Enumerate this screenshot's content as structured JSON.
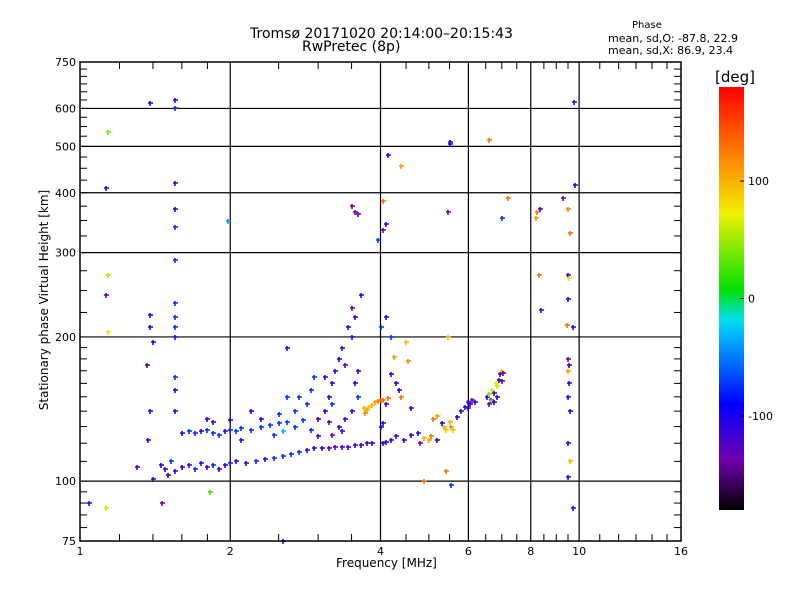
{
  "chart_data": {
    "type": "scatter",
    "title": "Tromsø 20171020 20:14:00–20:15:43",
    "subtitle": "RwPretec (8p)",
    "legend": {
      "title": "Phase",
      "line_o": "mean, sd,O: -87.8, 22.9",
      "line_x": "mean, sd,X:  86.9, 23.4",
      "placement": "top-right"
    },
    "xlabel": "Frequency [MHz]",
    "ylabel": "Stationary phase Virtual Height [km]",
    "xscale": "log2",
    "yscale": "log10",
    "xlim": [
      1,
      16
    ],
    "ylim": [
      75,
      750
    ],
    "xticks": [
      "1",
      "2",
      "4",
      "6",
      "8",
      "10",
      "16"
    ],
    "xtick_values": [
      1,
      2,
      4,
      6,
      8,
      10,
      16
    ],
    "yticks": [
      "75",
      "100",
      "200",
      "300",
      "400",
      "500",
      "600",
      "750"
    ],
    "ytick_values": [
      75,
      100,
      200,
      300,
      400,
      500,
      600,
      750
    ],
    "grid_x": [
      2,
      4,
      6,
      8,
      10
    ],
    "grid_y": [
      100,
      200,
      300,
      400,
      500,
      600
    ],
    "colorbar": {
      "label": "[deg]",
      "range": [
        -180,
        180
      ],
      "ticks": [
        "100",
        "0",
        "-100"
      ],
      "tick_values": [
        100,
        0,
        -100
      ]
    },
    "point_format": [
      "frequency_MHz",
      "height_km",
      "phase_deg"
    ],
    "points": [
      [
        1.45,
        108,
        -110
      ],
      [
        1.48,
        106,
        -110
      ],
      [
        1.52,
        110,
        -75
      ],
      [
        1.55,
        105,
        -110
      ],
      [
        1.6,
        107,
        -110
      ],
      [
        1.65,
        108,
        -110
      ],
      [
        1.7,
        106,
        -75
      ],
      [
        1.75,
        109,
        -110
      ],
      [
        1.8,
        107,
        -110
      ],
      [
        1.85,
        108,
        -75
      ],
      [
        1.9,
        106,
        -110
      ],
      [
        1.95,
        108,
        -110
      ],
      [
        2.0,
        109,
        -75
      ],
      [
        2.05,
        110,
        -110
      ],
      [
        2.15,
        109,
        -110
      ],
      [
        2.25,
        110,
        -75
      ],
      [
        2.35,
        111,
        -110
      ],
      [
        2.45,
        112,
        -75
      ],
      [
        2.55,
        113,
        -75
      ],
      [
        2.65,
        114,
        -75
      ],
      [
        2.75,
        115,
        -75
      ],
      [
        2.85,
        116,
        -110
      ],
      [
        2.95,
        117,
        -110
      ],
      [
        3.05,
        117,
        -110
      ],
      [
        3.15,
        117,
        -120
      ],
      [
        3.25,
        118,
        -120
      ],
      [
        3.35,
        118,
        -120
      ],
      [
        3.45,
        118,
        -110
      ],
      [
        3.55,
        119,
        -120
      ],
      [
        3.65,
        119,
        -110
      ],
      [
        3.75,
        120,
        -110
      ],
      [
        3.85,
        120,
        -110
      ],
      [
        1.3,
        107,
        -120
      ],
      [
        1.5,
        103,
        -110
      ],
      [
        1.4,
        101,
        -110
      ],
      [
        1.6,
        126,
        -110
      ],
      [
        1.65,
        127,
        -75
      ],
      [
        1.7,
        126,
        -75
      ],
      [
        1.75,
        127,
        -110
      ],
      [
        1.8,
        128,
        -75
      ],
      [
        1.85,
        126,
        -75
      ],
      [
        1.9,
        125,
        -75
      ],
      [
        1.95,
        127,
        -110
      ],
      [
        2.0,
        128,
        -75
      ],
      [
        2.05,
        127,
        -75
      ],
      [
        2.1,
        129,
        -75
      ],
      [
        2.2,
        128,
        -75
      ],
      [
        2.3,
        130,
        -75
      ],
      [
        2.4,
        131,
        -75
      ],
      [
        2.5,
        132,
        -75
      ],
      [
        2.6,
        133,
        -75
      ],
      [
        2.7,
        130,
        -75
      ],
      [
        2.8,
        134,
        -75
      ],
      [
        2.9,
        128,
        -75
      ],
      [
        3.0,
        124,
        -110
      ],
      [
        3.0,
        135,
        -110
      ],
      [
        3.1,
        140,
        -110
      ],
      [
        3.15,
        150,
        -110
      ],
      [
        3.2,
        145,
        -75
      ],
      [
        3.2,
        160,
        -110
      ],
      [
        3.1,
        165,
        -110
      ],
      [
        3.25,
        170,
        -110
      ],
      [
        3.3,
        130,
        -110
      ],
      [
        3.3,
        180,
        -110
      ],
      [
        3.4,
        135,
        -120
      ],
      [
        3.4,
        175,
        -140
      ],
      [
        3.35,
        190,
        -110
      ],
      [
        3.5,
        140,
        -110
      ],
      [
        3.5,
        200,
        -110
      ],
      [
        3.45,
        210,
        -110
      ],
      [
        3.55,
        220,
        -110
      ],
      [
        3.55,
        160,
        -110
      ],
      [
        3.6,
        170,
        -110
      ],
      [
        3.6,
        150,
        -75
      ],
      [
        3.5,
        230,
        -140
      ],
      [
        3.65,
        245,
        -110
      ],
      [
        2.85,
        145,
        -75
      ],
      [
        2.9,
        155,
        -75
      ],
      [
        2.95,
        165,
        -75
      ],
      [
        2.75,
        150,
        -75
      ],
      [
        2.7,
        140,
        -75
      ],
      [
        2.5,
        138,
        -75
      ],
      [
        2.6,
        150,
        -75
      ],
      [
        2.3,
        135,
        -110
      ],
      [
        2.2,
        140,
        -110
      ],
      [
        1.8,
        135,
        -110
      ],
      [
        1.85,
        133,
        -110
      ],
      [
        2.45,
        125,
        -75
      ],
      [
        2.55,
        127,
        -30
      ],
      [
        2.1,
        122,
        -110
      ],
      [
        2.0,
        134,
        -110
      ],
      [
        3.2,
        125,
        -140
      ],
      [
        3.35,
        127,
        -110
      ],
      [
        3.15,
        133,
        -140
      ],
      [
        3.7,
        142,
        100
      ],
      [
        3.75,
        141,
        110
      ],
      [
        3.8,
        143,
        90
      ],
      [
        3.85,
        144,
        100
      ],
      [
        3.9,
        146,
        110
      ],
      [
        3.95,
        147,
        120
      ],
      [
        4.0,
        148,
        140
      ],
      [
        4.05,
        148,
        130
      ],
      [
        4.15,
        149,
        130
      ],
      [
        3.72,
        139,
        120
      ],
      [
        4.1,
        145,
        -110
      ],
      [
        4.0,
        130,
        -110
      ],
      [
        4.05,
        132,
        -110
      ],
      [
        4.05,
        120,
        -110
      ],
      [
        4.1,
        121,
        -110
      ],
      [
        4.2,
        122,
        -110
      ],
      [
        4.3,
        124,
        -110
      ],
      [
        4.45,
        122,
        -110
      ],
      [
        4.6,
        125,
        -110
      ],
      [
        4.75,
        126,
        -110
      ],
      [
        4.8,
        120,
        -140
      ],
      [
        4.9,
        123,
        100
      ],
      [
        5.0,
        122,
        110
      ],
      [
        5.05,
        124,
        130
      ],
      [
        5.2,
        122,
        -110
      ],
      [
        5.3,
        132,
        -110
      ],
      [
        5.35,
        130,
        100
      ],
      [
        5.4,
        128,
        90
      ],
      [
        5.5,
        133,
        100
      ],
      [
        5.55,
        130,
        120
      ],
      [
        5.6,
        128,
        90
      ],
      [
        5.7,
        136,
        -110
      ],
      [
        5.8,
        140,
        -110
      ],
      [
        5.9,
        143,
        -110
      ],
      [
        6.0,
        146,
        -110
      ],
      [
        6.05,
        145,
        -110
      ],
      [
        6.0,
        142,
        -110
      ],
      [
        5.1,
        135,
        130
      ],
      [
        5.2,
        137,
        110
      ],
      [
        4.6,
        142,
        -110
      ],
      [
        4.4,
        150,
        130
      ],
      [
        4.3,
        160,
        -110
      ],
      [
        4.2,
        167,
        -110
      ],
      [
        4.35,
        155,
        -110
      ],
      [
        4.5,
        195,
        100
      ],
      [
        4.55,
        178,
        120
      ],
      [
        4.2,
        200,
        -75
      ],
      [
        5.45,
        200,
        100
      ],
      [
        4.25,
        182,
        110
      ],
      [
        6.55,
        150,
        -110
      ],
      [
        6.6,
        152,
        40
      ],
      [
        6.65,
        148,
        -140
      ],
      [
        6.7,
        155,
        80
      ],
      [
        6.75,
        153,
        -110
      ],
      [
        6.8,
        160,
        70
      ],
      [
        6.85,
        158,
        60
      ],
      [
        6.9,
        163,
        -110
      ],
      [
        6.95,
        167,
        -110
      ],
      [
        7.0,
        170,
        90
      ],
      [
        6.7,
        147,
        40
      ],
      [
        6.75,
        146,
        -110
      ],
      [
        6.6,
        145,
        -130
      ],
      [
        7.05,
        168,
        -140
      ],
      [
        6.85,
        150,
        -110
      ],
      [
        6.2,
        146,
        -110
      ],
      [
        6.1,
        148,
        -140
      ],
      [
        7.0,
        162,
        -140
      ],
      [
        9.5,
        270,
        -110
      ],
      [
        9.55,
        265,
        80
      ],
      [
        9.5,
        240,
        -110
      ],
      [
        9.45,
        212,
        130
      ],
      [
        9.5,
        180,
        -140
      ],
      [
        9.55,
        175,
        -110
      ],
      [
        9.5,
        170,
        110
      ],
      [
        9.55,
        160,
        -110
      ],
      [
        9.5,
        150,
        -110
      ],
      [
        9.6,
        140,
        -110
      ],
      [
        9.5,
        120,
        -110
      ],
      [
        9.6,
        110,
        100
      ],
      [
        9.5,
        102,
        -110
      ],
      [
        9.7,
        88,
        -110
      ],
      [
        9.7,
        210,
        -110
      ],
      [
        9.3,
        390,
        -140
      ],
      [
        9.5,
        370,
        120
      ],
      [
        9.6,
        330,
        130
      ],
      [
        9.75,
        620,
        -110
      ],
      [
        9.8,
        415,
        -110
      ],
      [
        8.35,
        370,
        -110
      ],
      [
        8.25,
        365,
        130
      ],
      [
        7.2,
        390,
        130
      ],
      [
        7.0,
        355,
        -75
      ],
      [
        6.6,
        515,
        130
      ],
      [
        5.5,
        510,
        -110
      ],
      [
        5.5,
        505,
        -110
      ],
      [
        5.45,
        365,
        -140
      ],
      [
        4.4,
        455,
        110
      ],
      [
        4.15,
        480,
        -110
      ],
      [
        4.05,
        385,
        130
      ],
      [
        4.1,
        345,
        -110
      ],
      [
        4.05,
        335,
        -140
      ],
      [
        3.95,
        318,
        -75
      ],
      [
        4.0,
        210,
        -75
      ],
      [
        4.1,
        220,
        -110
      ],
      [
        3.5,
        375,
        -140
      ],
      [
        3.55,
        365,
        -140
      ],
      [
        3.6,
        362,
        -140
      ],
      [
        8.3,
        270,
        130
      ],
      [
        8.4,
        228,
        -110
      ],
      [
        8.2,
        355,
        110
      ],
      [
        1.55,
        625,
        -110
      ],
      [
        1.55,
        600,
        -75
      ],
      [
        1.38,
        615,
        -110
      ],
      [
        1.55,
        420,
        -110
      ],
      [
        1.55,
        370,
        -110
      ],
      [
        1.55,
        340,
        -75
      ],
      [
        1.55,
        290,
        -75
      ],
      [
        1.55,
        235,
        -75
      ],
      [
        1.55,
        220,
        -75
      ],
      [
        1.55,
        210,
        -75
      ],
      [
        1.55,
        200,
        -110
      ],
      [
        1.55,
        165,
        -75
      ],
      [
        1.55,
        155,
        -110
      ],
      [
        1.55,
        140,
        -110
      ],
      [
        1.38,
        222,
        -110
      ],
      [
        1.38,
        210,
        -110
      ],
      [
        1.4,
        195,
        -110
      ],
      [
        1.36,
        175,
        -150
      ],
      [
        1.38,
        140,
        -110
      ],
      [
        1.37,
        122,
        -110
      ],
      [
        1.14,
        535,
        40
      ],
      [
        1.13,
        410,
        -110
      ],
      [
        1.14,
        270,
        50
      ],
      [
        1.13,
        245,
        -140
      ],
      [
        1.14,
        205,
        80
      ],
      [
        1.13,
        88,
        60
      ],
      [
        1.04,
        90,
        -110
      ],
      [
        1.46,
        90,
        -140
      ],
      [
        1.98,
        350,
        -40
      ],
      [
        1.82,
        95,
        20
      ],
      [
        2.55,
        75,
        -110
      ],
      [
        4.9,
        100,
        130
      ],
      [
        5.55,
        98,
        -75
      ],
      [
        5.4,
        105,
        130
      ],
      [
        2.6,
        190,
        -110
      ]
    ]
  }
}
